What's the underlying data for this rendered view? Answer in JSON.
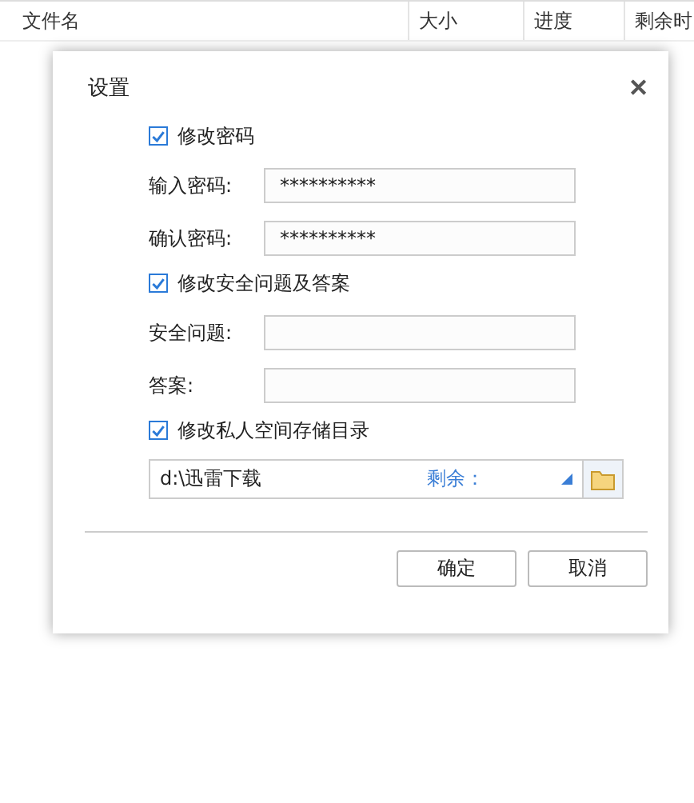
{
  "file_list": {
    "columns": [
      "文件名",
      "大小",
      "进度",
      "剩余时"
    ]
  },
  "dialog": {
    "title": "设置",
    "close": "✕",
    "sections": [
      {
        "label": "修改密码",
        "checked": true,
        "fields": [
          {
            "label": "输入密码:",
            "value": "**********"
          },
          {
            "label": "确认密码:",
            "value": "**********"
          }
        ]
      },
      {
        "label": "修改安全问题及答案",
        "checked": true,
        "fields": [
          {
            "label": "安全问题:"
          },
          {
            "label": "答案:"
          }
        ]
      },
      {
        "label": "修改私人空间存储目录",
        "checked": true,
        "directory": {
          "path": "d:\\迅雷下载",
          "free_label": "剩余："
        }
      }
    ],
    "buttons": [
      "确定",
      "取消"
    ]
  }
}
